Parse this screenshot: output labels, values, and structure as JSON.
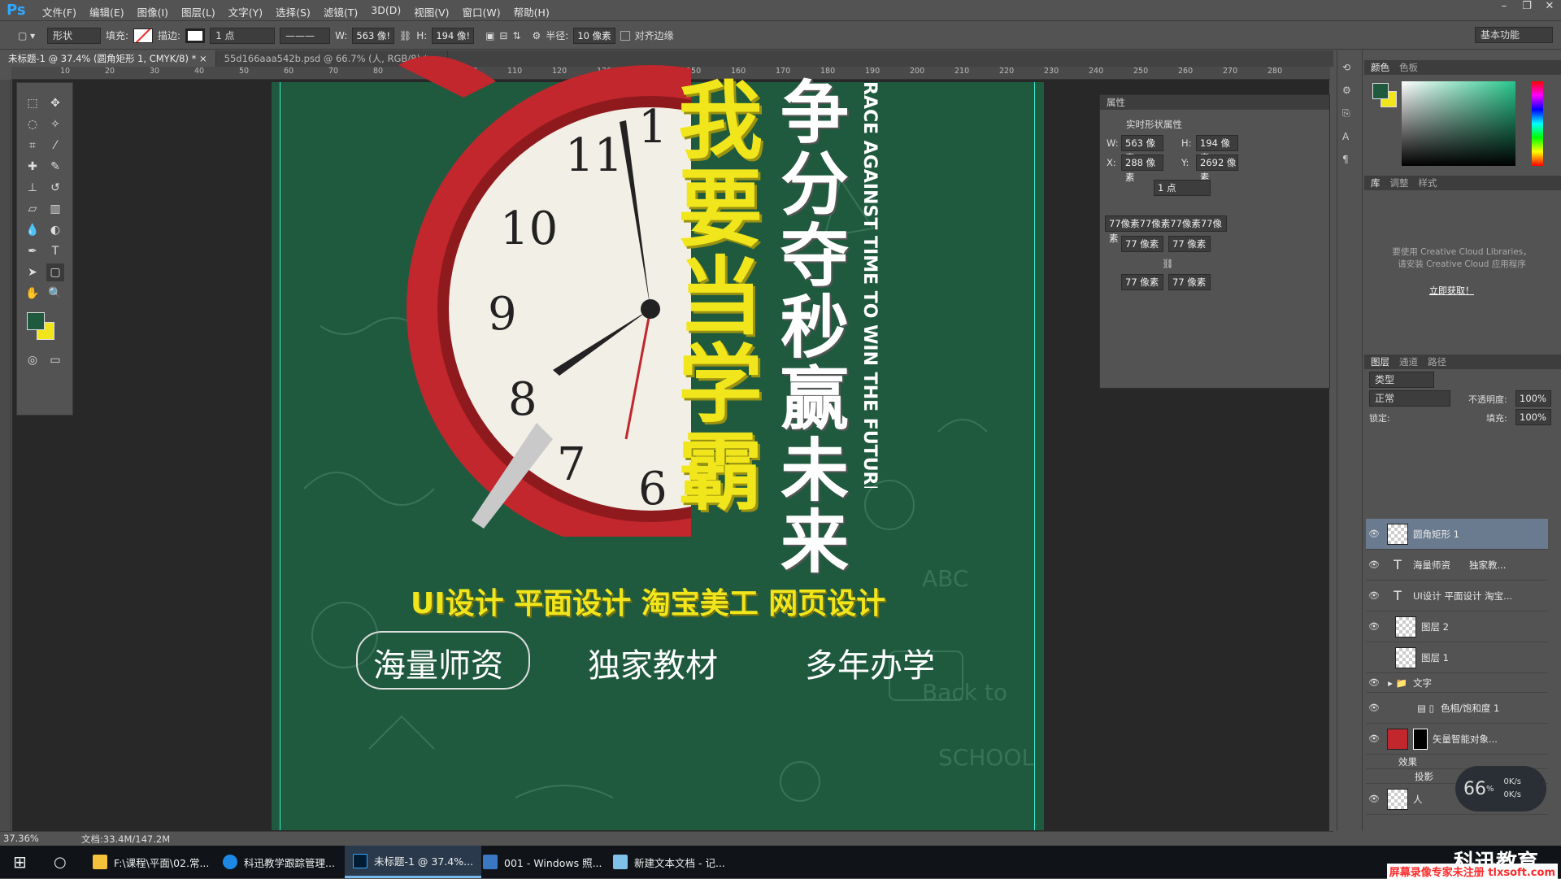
{
  "app": {
    "logo": "Ps"
  },
  "menu": [
    "文件(F)",
    "编辑(E)",
    "图像(I)",
    "图层(L)",
    "文字(Y)",
    "选择(S)",
    "滤镜(T)",
    "3D(D)",
    "视图(V)",
    "窗口(W)",
    "帮助(H)"
  ],
  "options": {
    "shape_mode": "形状",
    "fill_label": "填充:",
    "stroke_label": "描边:",
    "stroke_width": "1 点",
    "w_label": "W:",
    "w_value": "563 像!",
    "h_label": "H:",
    "h_value": "194 像!",
    "radius_label": "半径:",
    "radius_value": "10 像素",
    "align_edges": "对齐边缘",
    "workspace": "基本功能"
  },
  "tabs": [
    {
      "label": "未标题-1 @ 37.4% (圆角矩形 1, CMYK/8) *",
      "close": "×"
    },
    {
      "label": "55d166aaa542b.psd @ 66.7% (人, RGB/8) *",
      "close": "×"
    }
  ],
  "ruler": [
    "10",
    "20",
    "30",
    "40",
    "50",
    "60",
    "70",
    "80",
    "90",
    "100",
    "110",
    "120",
    "130",
    "140",
    "150",
    "160",
    "170",
    "180",
    "190",
    "200",
    "210",
    "220",
    "230",
    "240",
    "250",
    "260",
    "270",
    "280"
  ],
  "poster": {
    "slogan_yellow": "我要当学霸",
    "slogan_white": "争分夺秒赢未来",
    "slogan_en": "RACE AGAINST TIME TO WIN THE FUTURE",
    "courses": "UI设计  平面设计  淘宝美工  网页设计",
    "features": [
      "海量师资",
      "独家教材",
      "多年办学"
    ],
    "clock_numbers": [
      "11",
      "10",
      "9",
      "8",
      "7",
      "6",
      "1"
    ],
    "colors": {
      "bg": "#1f5a3f",
      "yellow": "#f1e61b",
      "clock_red": "#c1272d"
    }
  },
  "properties": {
    "title": "属性",
    "subtitle": "实时形状属性",
    "w_label": "W:",
    "w": "563 像素",
    "h_label": "H:",
    "h": "194 像素",
    "x_label": "X:",
    "x": "288 像素",
    "y_label": "Y:",
    "y": "2692 像素",
    "stroke": "1 点",
    "corners_all": "77像素77像素77像素77像素",
    "corner_tl": "77 像素",
    "corner_tr": "77 像素",
    "corner_bl": "77 像素",
    "corner_br": "77 像素"
  },
  "color_panel": {
    "tabs": [
      "颜色",
      "色板"
    ],
    "fg": "#1f5a3f",
    "bg": "#f1e61b"
  },
  "lib_panel": {
    "tabs": [
      "库",
      "调整",
      "样式"
    ],
    "notice": "要使用 Creative Cloud Libraries，请安装 Creative Cloud 应用程序",
    "link": "立即获取！"
  },
  "layers_panel": {
    "tabs": [
      "图层",
      "通道",
      "路径"
    ],
    "filter": "类型",
    "blend": "正常",
    "opacity_label": "不透明度:",
    "opacity": "100%",
    "lock_label": "锁定:",
    "fill_label": "填充:",
    "fill": "100%",
    "layers": [
      {
        "name": "圆角矩形 1",
        "type": "shape",
        "selected": true
      },
      {
        "name": "海量师资　　独家教...",
        "type": "text"
      },
      {
        "name": "UI设计  平面设计  淘宝...",
        "type": "text"
      },
      {
        "name": "图层 2",
        "type": "pixel"
      },
      {
        "name": "图层 1",
        "type": "pixel"
      },
      {
        "name": "文字",
        "type": "group"
      },
      {
        "name": "色相/饱和度 1",
        "type": "adjust"
      },
      {
        "name": "矢量智能对象...",
        "type": "smart"
      },
      {
        "name": "效果",
        "type": "effect"
      },
      {
        "name": "投影",
        "type": "effect"
      },
      {
        "name": "人",
        "type": "pixel"
      }
    ]
  },
  "status": {
    "zoom": "37.36%",
    "doc": "文档:33.4M/147.2M"
  },
  "speed": {
    "percent": "66",
    "unit": "%",
    "up": "0K/s",
    "down": "0K/s"
  },
  "taskbar": [
    {
      "label": "F:\\课程\\平面\\02.常..."
    },
    {
      "label": "科迅教学跟踪管理..."
    },
    {
      "label": "未标题-1 @ 37.4%..."
    },
    {
      "label": "001 - Windows 照..."
    },
    {
      "label": "新建文本文档 - 记..."
    }
  ],
  "brand": "科迅教育",
  "watermark": "屏幕录像专家未注册 tlxsoft.com"
}
